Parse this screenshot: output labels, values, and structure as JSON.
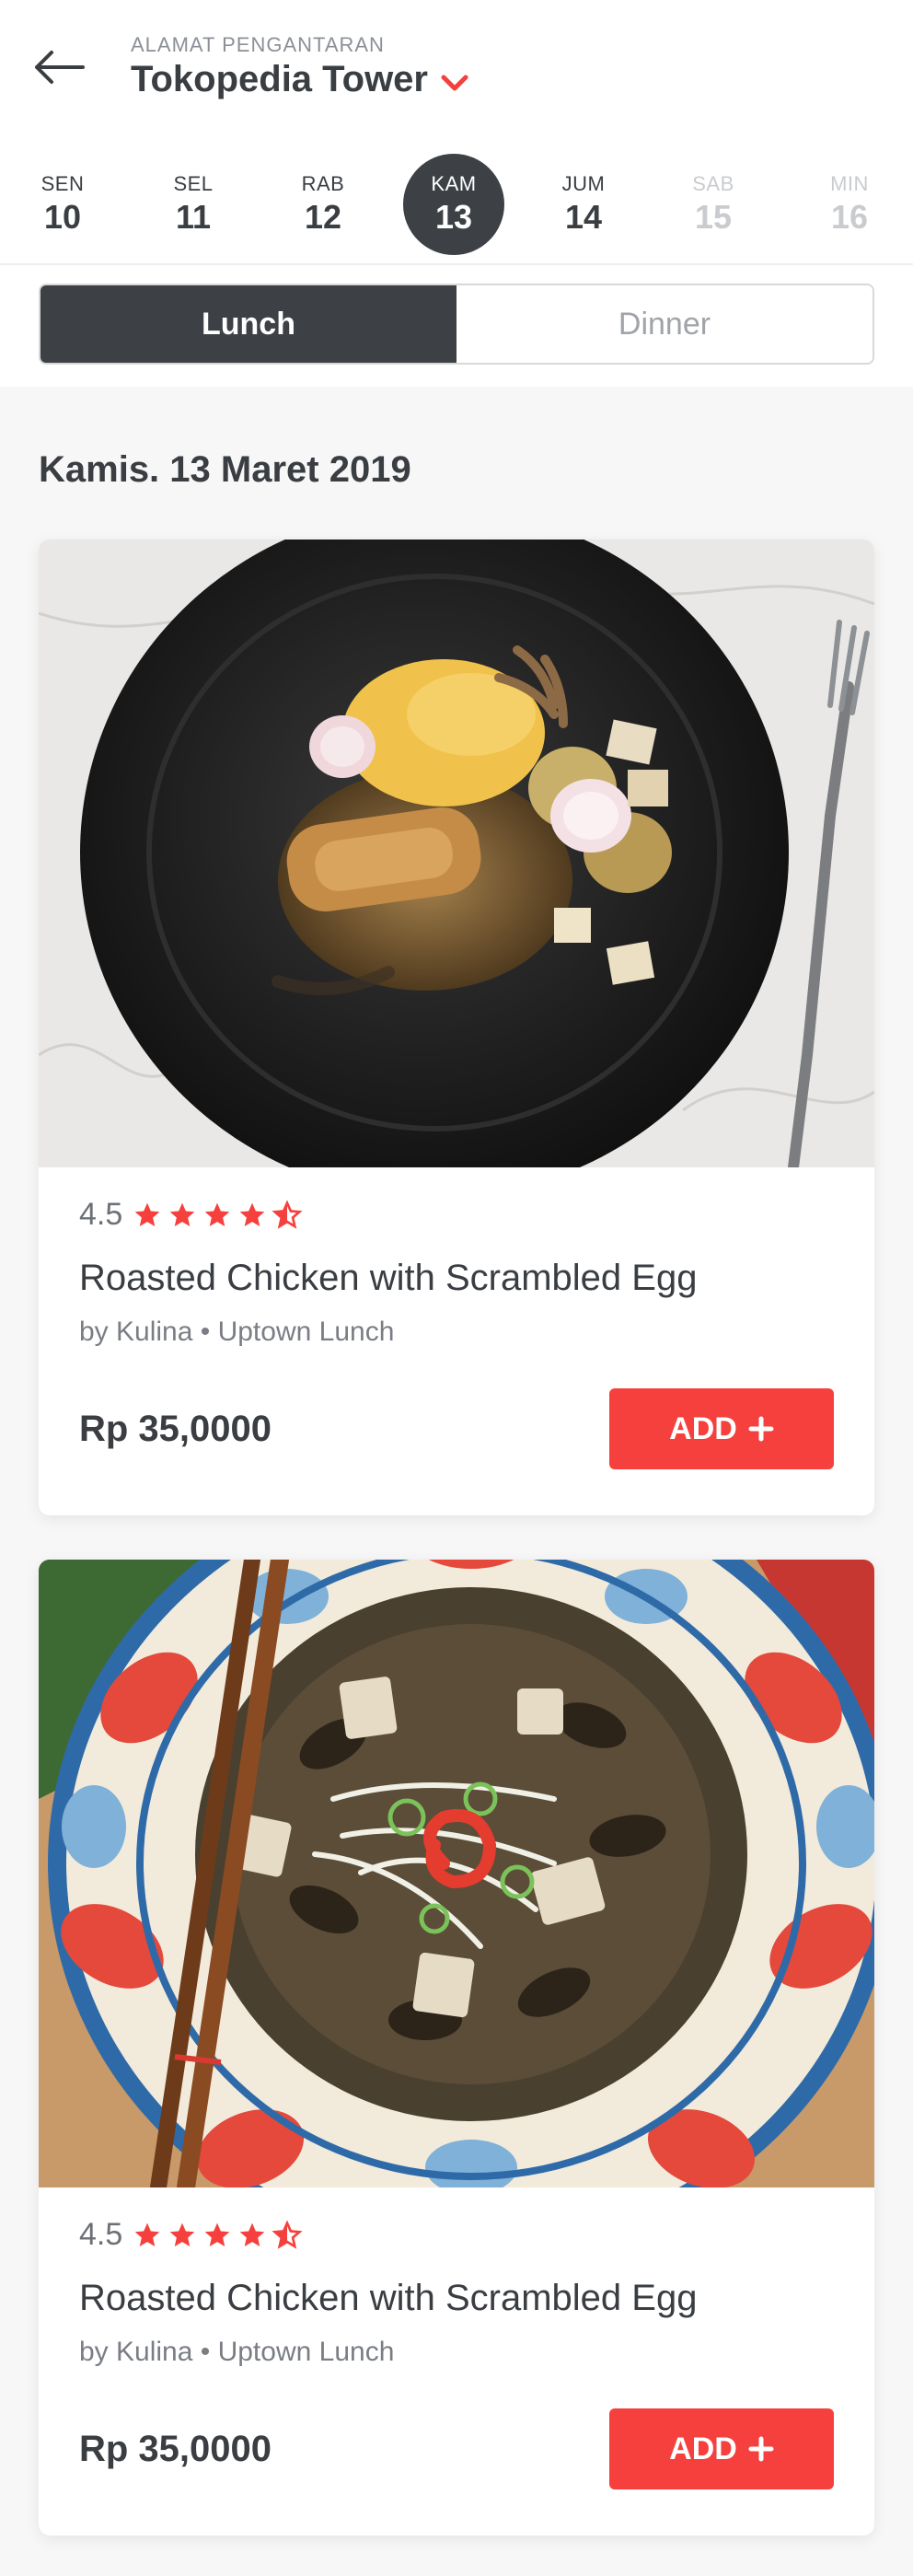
{
  "header": {
    "address_label": "ALAMAT PENGANTARAN",
    "address_value": "Tokopedia Tower"
  },
  "days": [
    {
      "name": "SEN",
      "date": "10",
      "state": "normal"
    },
    {
      "name": "SEL",
      "date": "11",
      "state": "normal"
    },
    {
      "name": "RAB",
      "date": "12",
      "state": "normal"
    },
    {
      "name": "KAM",
      "date": "13",
      "state": "selected"
    },
    {
      "name": "JUM",
      "date": "14",
      "state": "normal"
    },
    {
      "name": "SAB",
      "date": "15",
      "state": "disabled"
    },
    {
      "name": "MIN",
      "date": "16",
      "state": "disabled"
    }
  ],
  "meal_tabs": {
    "lunch": "Lunch",
    "dinner": "Dinner",
    "active": "lunch"
  },
  "date_heading": "Kamis. 13 Maret 2019",
  "menu": [
    {
      "rating": "4.5",
      "stars": 4.5,
      "name": "Roasted Chicken with Scrambled Egg",
      "vendor": "by Kulina • Uptown Lunch",
      "price": "Rp 35,0000",
      "add_label": "ADD",
      "image": "roasted-chicken-plate-photo"
    },
    {
      "rating": "4.5",
      "stars": 4.5,
      "name": "Roasted Chicken with Scrambled Egg",
      "vendor": "by Kulina • Uptown Lunch",
      "price": "Rp 35,0000",
      "add_label": "ADD",
      "image": "mushroom-fried-rice-plate-photo"
    }
  ],
  "colors": {
    "accent": "#f5403d",
    "dark": "#3d4145",
    "text": "#3a3e42",
    "muted": "#c9cbce"
  }
}
